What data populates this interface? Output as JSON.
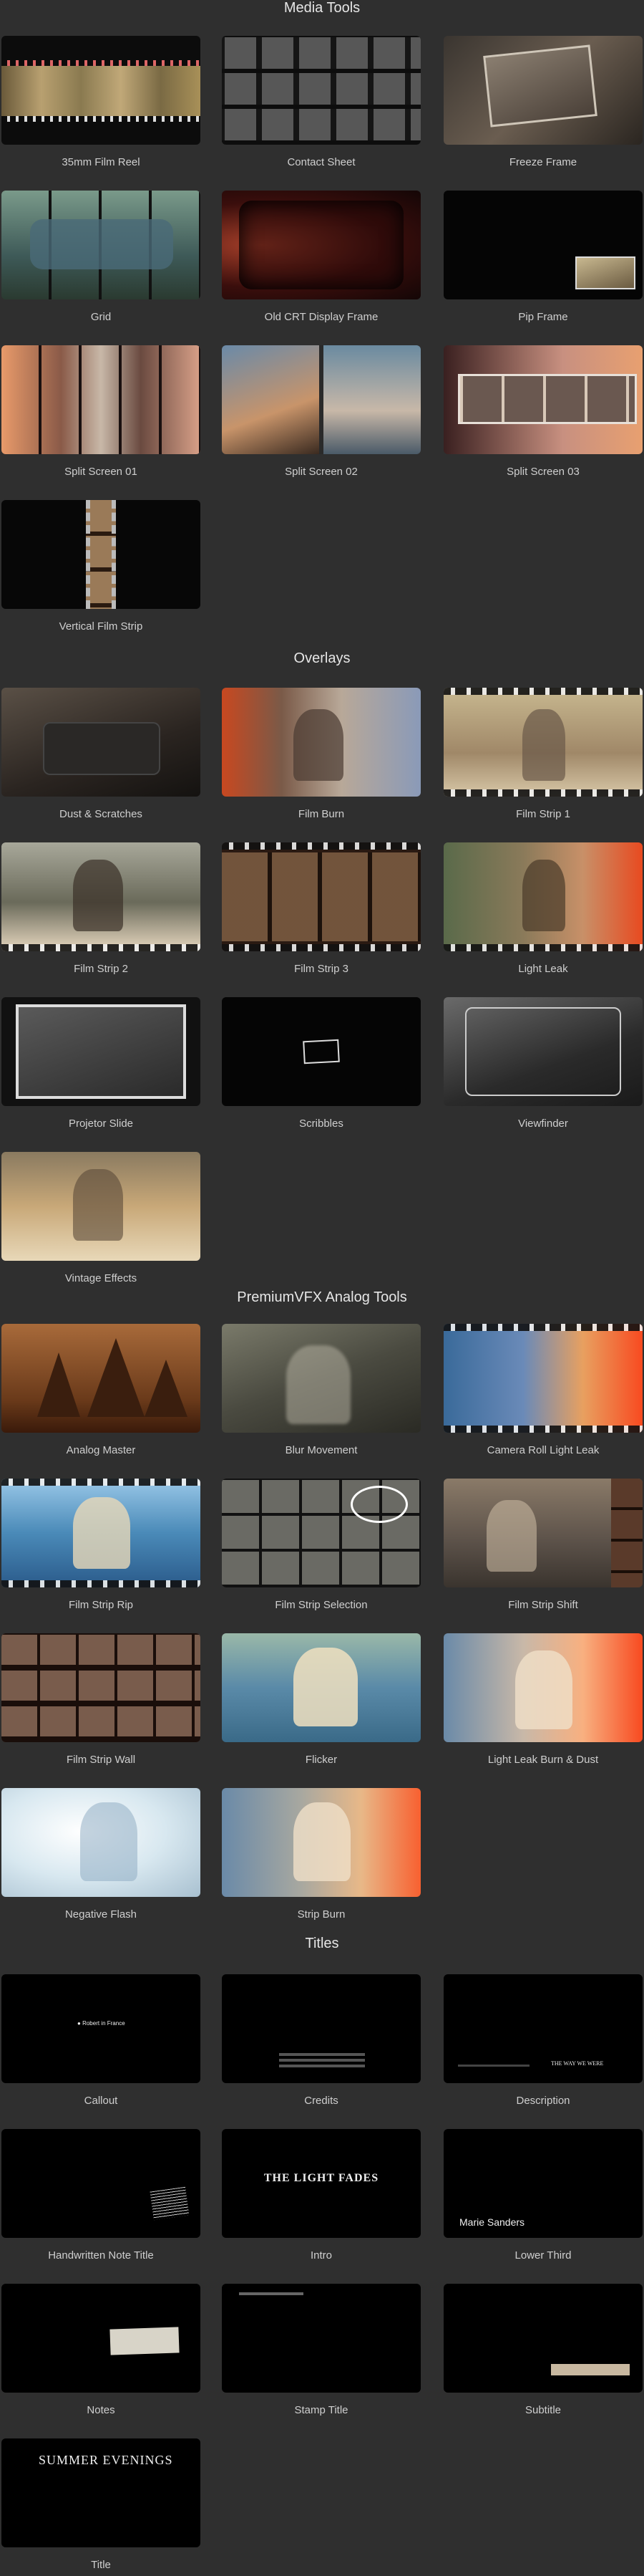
{
  "sections": {
    "media_tools": "Media Tools",
    "overlays": "Overlays",
    "premium": "PremiumVFX Analog Tools",
    "titles": "Titles"
  },
  "media_tools": [
    {
      "label": "35mm Film Reel"
    },
    {
      "label": "Contact Sheet"
    },
    {
      "label": "Freeze Frame"
    },
    {
      "label": "Grid"
    },
    {
      "label": "Old CRT Display Frame"
    },
    {
      "label": "Pip Frame"
    },
    {
      "label": "Split Screen 01"
    },
    {
      "label": "Split Screen 02"
    },
    {
      "label": "Split Screen 03"
    },
    {
      "label": "Vertical Film Strip"
    }
  ],
  "overlays": [
    {
      "label": "Dust & Scratches"
    },
    {
      "label": "Film Burn"
    },
    {
      "label": "Film Strip 1"
    },
    {
      "label": "Film Strip 2"
    },
    {
      "label": "Film Strip 3"
    },
    {
      "label": "Light Leak"
    },
    {
      "label": "Projetor Slide"
    },
    {
      "label": "Scribbles"
    },
    {
      "label": "Viewfinder"
    },
    {
      "label": "Vintage Effects"
    }
  ],
  "premium": [
    {
      "label": "Analog Master"
    },
    {
      "label": "Blur Movement"
    },
    {
      "label": "Camera Roll Light Leak"
    },
    {
      "label": "Film Strip Rip"
    },
    {
      "label": "Film Strip Selection"
    },
    {
      "label": "Film Strip Shift"
    },
    {
      "label": "Film Strip Wall"
    },
    {
      "label": "Flicker"
    },
    {
      "label": "Light Leak Burn & Dust"
    },
    {
      "label": "Negative Flash"
    },
    {
      "label": "Strip Burn"
    }
  ],
  "titles": [
    {
      "label": "Callout",
      "thumb_text": "Robert in France"
    },
    {
      "label": "Credits"
    },
    {
      "label": "Description",
      "thumb_text": "THE WAY WE WERE"
    },
    {
      "label": "Handwritten Note Title"
    },
    {
      "label": "Intro",
      "thumb_text": "THE LIGHT FADES"
    },
    {
      "label": "Lower Third",
      "thumb_text": "Marie Sanders"
    },
    {
      "label": "Notes"
    },
    {
      "label": "Stamp Title"
    },
    {
      "label": "Subtitle"
    },
    {
      "label": "Title",
      "thumb_text": "SUMMER EVENINGS"
    }
  ],
  "colors": {
    "background": "#2f2f2f",
    "text": "#cfcfcf",
    "heading": "#e6e6e6"
  }
}
